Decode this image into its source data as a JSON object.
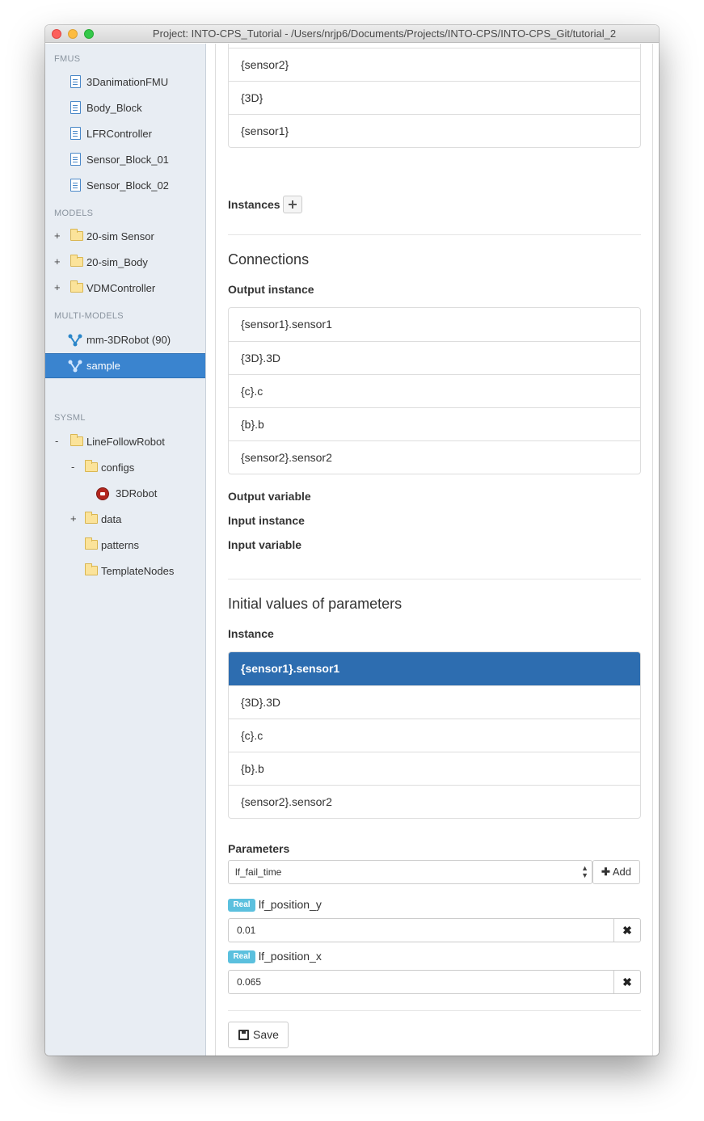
{
  "window": {
    "title": "Project: INTO-CPS_Tutorial - /Users/nrjp6/Documents/Projects/INTO-CPS/INTO-CPS_Git/tutorial_2"
  },
  "sidebar": {
    "fmus_header": "FMUS",
    "fmus": [
      "3DanimationFMU",
      "Body_Block",
      "LFRController",
      "Sensor_Block_01",
      "Sensor_Block_02"
    ],
    "models_header": "MODELS",
    "models": [
      {
        "expander": "+",
        "label": "20-sim Sensor"
      },
      {
        "expander": "+",
        "label": "20-sim_Body"
      },
      {
        "expander": "+",
        "label": "VDMController"
      }
    ],
    "multimodels_header": "MULTI-MODELS",
    "multimodels": [
      "mm-3DRobot (90)",
      "sample"
    ],
    "sysml_header": "SYSML",
    "sysml": [
      {
        "expander": "-",
        "label": "LineFollowRobot"
      },
      {
        "expander": "-",
        "label": "configs"
      },
      {
        "expander": "",
        "label": "3DRobot"
      },
      {
        "expander": "+",
        "label": "data"
      },
      {
        "expander": "",
        "label": "patterns"
      },
      {
        "expander": "",
        "label": "TemplateNodes"
      }
    ]
  },
  "main": {
    "fmu_list": [
      "{sensor2}",
      "{3D}",
      "{sensor1}"
    ],
    "instances_label": "Instances",
    "connections": {
      "heading": "Connections",
      "output_instance_label": "Output instance",
      "output_instances": [
        "{sensor1}.sensor1",
        "{3D}.3D",
        "{c}.c",
        "{b}.b",
        "{sensor2}.sensor2"
      ],
      "output_variable_label": "Output variable",
      "input_instance_label": "Input instance",
      "input_variable_label": "Input variable"
    },
    "initial_values": {
      "heading": "Initial values of parameters",
      "instance_label": "Instance",
      "instances": [
        "{sensor1}.sensor1",
        "{3D}.3D",
        "{c}.c",
        "{b}.b",
        "{sensor2}.sensor2"
      ],
      "selected_index": 0,
      "parameters_label": "Parameters",
      "select_value": "lf_fail_time",
      "add_label": "Add",
      "params": [
        {
          "type": "Real",
          "name": "lf_position_y",
          "value": "0.01"
        },
        {
          "type": "Real",
          "name": "lf_position_x",
          "value": "0.065"
        }
      ]
    },
    "save_label": "Save"
  }
}
